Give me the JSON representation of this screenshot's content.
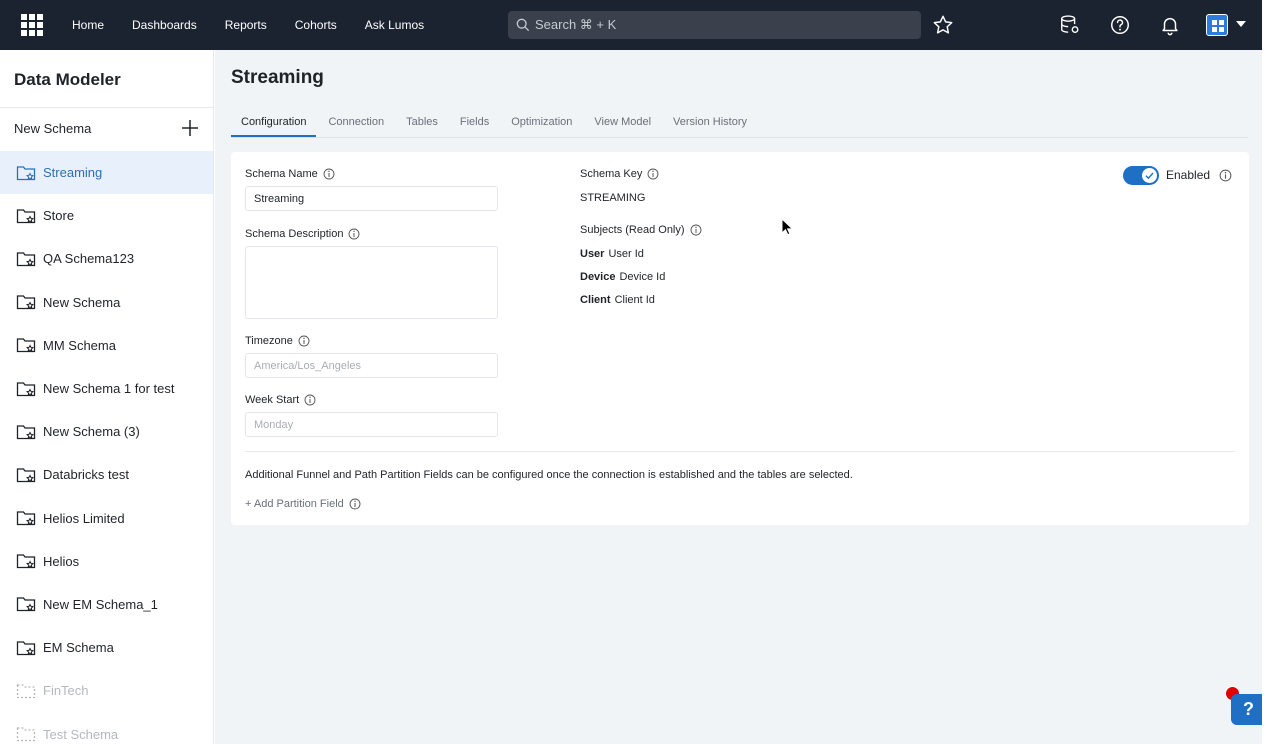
{
  "topbar": {
    "nav": [
      "Home",
      "Dashboards",
      "Reports",
      "Cohorts",
      "Ask Lumos"
    ],
    "search_placeholder": "Search ⌘ + K"
  },
  "sidebar": {
    "title": "Data Modeler",
    "new_schema_label": "New Schema",
    "items": [
      {
        "label": "Streaming",
        "state": "active"
      },
      {
        "label": "Store",
        "state": "normal"
      },
      {
        "label": "QA Schema123",
        "state": "normal"
      },
      {
        "label": "New Schema",
        "state": "normal"
      },
      {
        "label": "MM Schema",
        "state": "normal"
      },
      {
        "label": "New Schema 1 for test",
        "state": "normal"
      },
      {
        "label": "New Schema (3)",
        "state": "normal"
      },
      {
        "label": "Databricks test",
        "state": "normal"
      },
      {
        "label": "Helios Limited",
        "state": "normal"
      },
      {
        "label": "Helios",
        "state": "normal"
      },
      {
        "label": "New EM Schema_1",
        "state": "normal"
      },
      {
        "label": "EM Schema",
        "state": "normal"
      },
      {
        "label": "FinTech",
        "state": "disabled"
      },
      {
        "label": "Test Schema",
        "state": "disabled"
      }
    ]
  },
  "main": {
    "title": "Streaming",
    "tabs": [
      "Configuration",
      "Connection",
      "Tables",
      "Fields",
      "Optimization",
      "View Model",
      "Version History"
    ],
    "active_tab": "Configuration",
    "form": {
      "schema_name_label": "Schema Name",
      "schema_name_value": "Streaming",
      "schema_description_label": "Schema Description",
      "timezone_label": "Timezone",
      "timezone_placeholder": "America/Los_Angeles",
      "week_start_label": "Week Start",
      "week_start_placeholder": "Monday",
      "schema_key_label": "Schema Key",
      "schema_key_value": "STREAMING",
      "subjects_label": "Subjects (Read Only)",
      "subjects": [
        {
          "name": "User",
          "id": "User Id"
        },
        {
          "name": "Device",
          "id": "Device Id"
        },
        {
          "name": "Client",
          "id": "Client Id"
        }
      ],
      "enabled_label": "Enabled",
      "partition_note": "Additional Funnel and Path Partition Fields can be configured once the connection is established and the tables are selected.",
      "add_partition_label": "+ Add Partition Field"
    }
  },
  "help_label": "?",
  "colors": {
    "accent": "#1f6fc4",
    "topbar": "#1b2230",
    "active_item_bg": "#e8f1fb"
  }
}
